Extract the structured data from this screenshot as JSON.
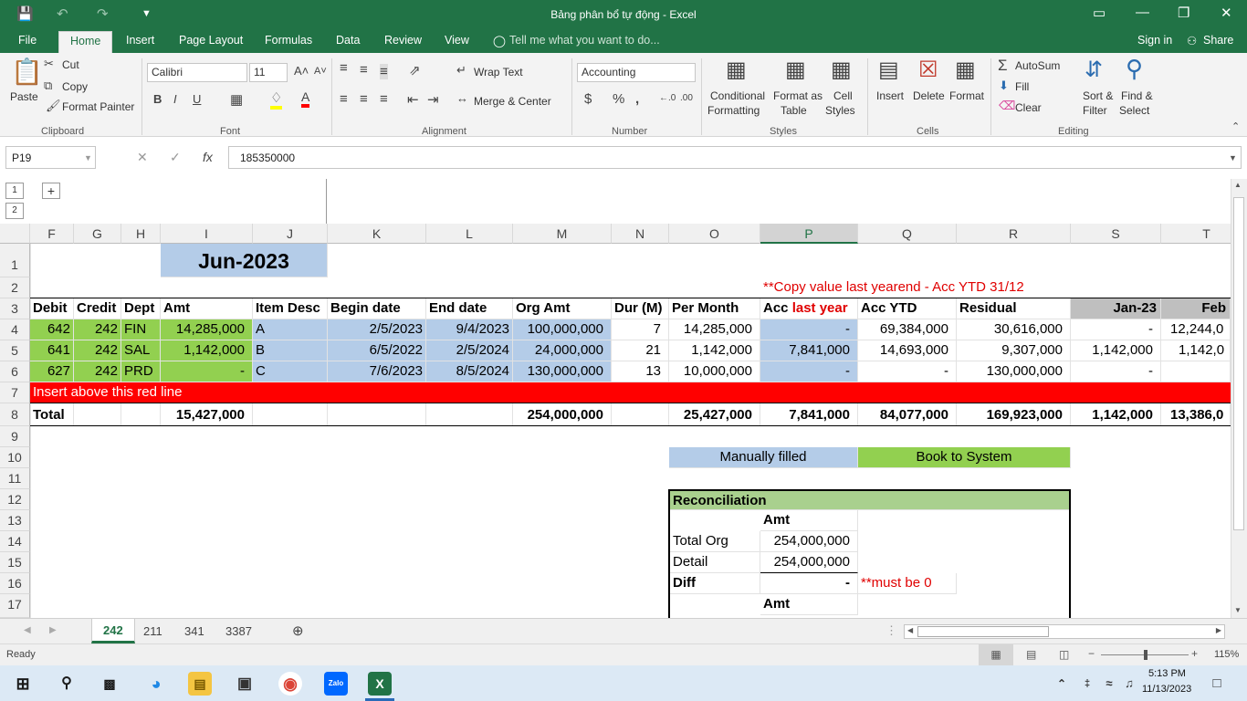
{
  "window": {
    "title": "Bảng phân bổ tự động - Excel"
  },
  "ribbon_tabs": [
    "File",
    "Home",
    "Insert",
    "Page Layout",
    "Formulas",
    "Data",
    "Review",
    "View"
  ],
  "tell_me": "Tell me what you want to do...",
  "signin": "Sign in",
  "share": "Share",
  "clipboard": {
    "paste": "Paste",
    "cut": "Cut",
    "copy": "Copy",
    "format_painter": "Format Painter",
    "group": "Clipboard"
  },
  "font": {
    "name": "Calibri",
    "size": "11",
    "group": "Font"
  },
  "alignment": {
    "wrap": "Wrap Text",
    "merge": "Merge & Center",
    "group": "Alignment"
  },
  "number": {
    "format": "Accounting",
    "group": "Number"
  },
  "styles": {
    "cond_1": "Conditional",
    "cond_2": "Formatting",
    "fmt_1": "Format as",
    "fmt_2": "Table",
    "cell_1": "Cell",
    "cell_2": "Styles",
    "group": "Styles"
  },
  "cells": {
    "insert": "Insert",
    "delete": "Delete",
    "format": "Format",
    "group": "Cells"
  },
  "editing": {
    "autosum": "AutoSum",
    "fill": "Fill",
    "clear": "Clear",
    "sort_1": "Sort &",
    "sort_2": "Filter",
    "find_1": "Find &",
    "find_2": "Select",
    "group": "Editing"
  },
  "formula_bar": {
    "name_box": "P19",
    "fx": "fx",
    "value": "185350000"
  },
  "outline_levels": [
    "1",
    "2"
  ],
  "columns": [
    "F",
    "G",
    "H",
    "I",
    "J",
    "K",
    "L",
    "M",
    "N",
    "O",
    "P",
    "Q",
    "R",
    "S",
    "T"
  ],
  "rows": [
    "1",
    "2",
    "3",
    "4",
    "5",
    "6",
    "7",
    "8",
    "9",
    "10",
    "11",
    "12",
    "13",
    "14",
    "15",
    "16",
    "17"
  ],
  "sheet": {
    "month_header": "Jun-2023",
    "note_row2": "**Copy value last yearend - Acc YTD 31/12",
    "headers": {
      "F": "Debit",
      "G": "Credit",
      "H": "Dept",
      "I": "Amt",
      "J": "Item Desc",
      "K": "Begin date",
      "L": "End date",
      "M": "Org Amt",
      "N": "Dur (M)",
      "O": "Per Month",
      "P1": "Acc ",
      "P2": "last year",
      "Q": "Acc YTD",
      "R": "Residual",
      "S": "Jan-23",
      "T": "Feb"
    },
    "data_rows": [
      {
        "F": "642",
        "G": "242",
        "H": "FIN",
        "I": "14,285,000",
        "J": "A",
        "K": "2/5/2023",
        "L": "9/4/2023",
        "M": "100,000,000",
        "N": "7",
        "O": "14,285,000",
        "P": "-",
        "Q": "69,384,000",
        "R": "30,616,000",
        "S": "-",
        "T": "12,244,0"
      },
      {
        "F": "641",
        "G": "242",
        "H": "SAL",
        "I": "1,142,000",
        "J": "B",
        "K": "6/5/2022",
        "L": "2/5/2024",
        "M": "24,000,000",
        "N": "21",
        "O": "1,142,000",
        "P": "7,841,000",
        "Q": "14,693,000",
        "R": "9,307,000",
        "S": "1,142,000",
        "T": "1,142,0"
      },
      {
        "F": "627",
        "G": "242",
        "H": "PRD",
        "I": "-",
        "J": "C",
        "K": "7/6/2023",
        "L": "8/5/2024",
        "M": "130,000,000",
        "N": "13",
        "O": "10,000,000",
        "P": "-",
        "Q": "-",
        "R": "130,000,000",
        "S": "-",
        "T": ""
      }
    ],
    "insert_note": "Insert above this red line",
    "total": {
      "F": "Total",
      "I": "15,427,000",
      "M": "254,000,000",
      "O": "25,427,000",
      "P": "7,841,000",
      "Q": "84,077,000",
      "R": "169,923,000",
      "S": "1,142,000",
      "T": "13,386,0"
    },
    "legend": {
      "manual": "Manually filled",
      "book": "Book to System"
    },
    "recon": {
      "title": "Reconciliation",
      "amt": "Amt",
      "total_org_label": "Total Org",
      "total_org": "254,000,000",
      "detail_label": "Detail",
      "detail": "254,000,000",
      "diff_label": "Diff",
      "diff": "-",
      "must_be": "**must be 0",
      "amt2": "Amt"
    }
  },
  "sheet_tabs": [
    "242",
    "211",
    "341",
    "3387"
  ],
  "status": {
    "ready": "Ready",
    "zoom": "115%"
  },
  "clock": {
    "time": "5:13 PM",
    "date": "11/13/2023"
  },
  "colors": {
    "excel_green": "#217346",
    "fill_green": "#92d050",
    "fill_blue": "#b4cce8",
    "red": "#ff0000"
  }
}
